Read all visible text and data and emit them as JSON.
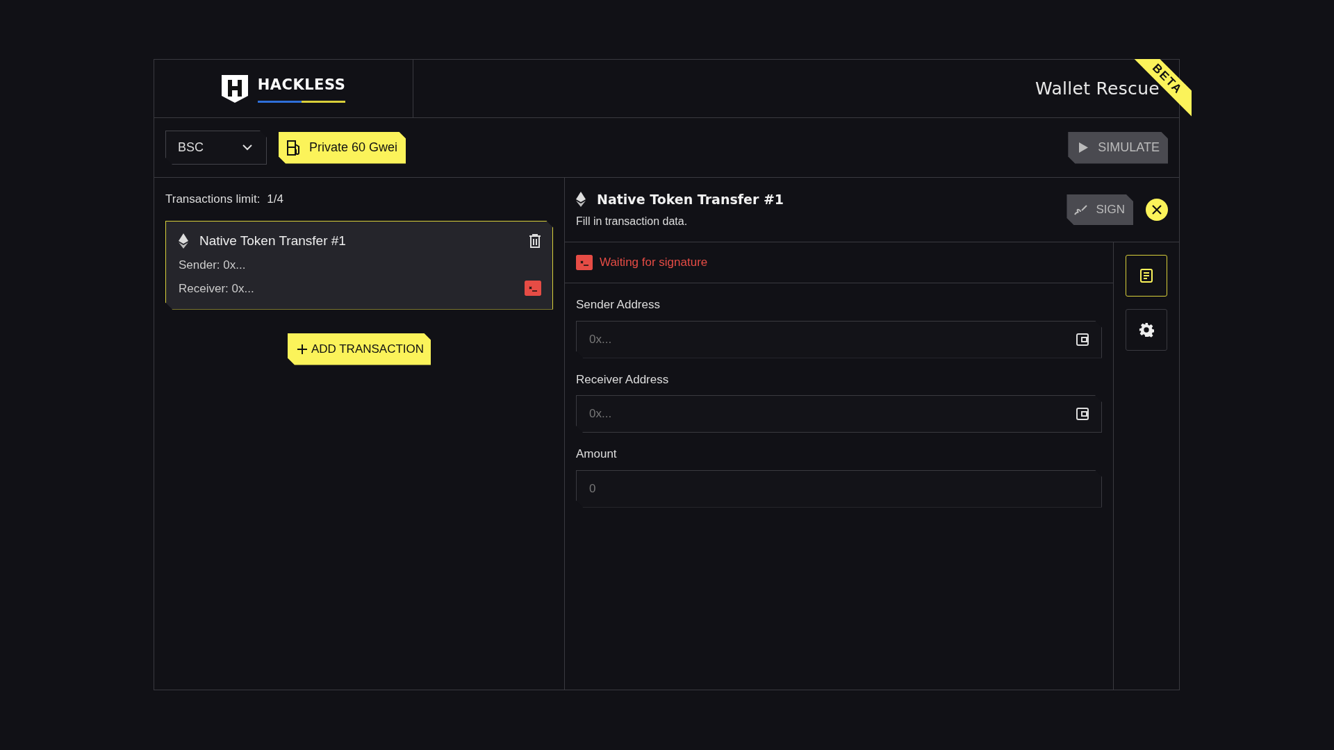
{
  "brand": {
    "name": "HACKLESS"
  },
  "app_title": "Wallet Rescue",
  "ribbon": "BETA",
  "toolbar": {
    "network": "BSC",
    "gas": "Private 60 Gwei",
    "simulate": {
      "label": "SIMULATE",
      "disabled": true
    }
  },
  "transactions": {
    "limit_label": "Transactions limit:",
    "limit_value": "1/4",
    "items": [
      {
        "title": "Native Token Transfer #1",
        "sender": "Sender: 0x...",
        "receiver": "Receiver: 0x...",
        "selected": true,
        "signed": false
      }
    ],
    "add_button": "ADD TRANSACTION"
  },
  "detail": {
    "title": "Native Token Transfer #1",
    "subtitle": "Fill in transaction data.",
    "sign": {
      "label": "SIGN",
      "disabled": true
    },
    "status": "Waiting for signature",
    "fields": [
      {
        "label": "Sender Address",
        "placeholder": "0x...",
        "kind": "wallet"
      },
      {
        "label": "Receiver Address",
        "placeholder": "0x...",
        "kind": "wallet"
      },
      {
        "label": "Amount",
        "placeholder": "0",
        "kind": "plain"
      }
    ]
  },
  "side_tools": [
    {
      "kind": "notes",
      "selected": true
    },
    {
      "kind": "settings",
      "selected": false
    }
  ]
}
